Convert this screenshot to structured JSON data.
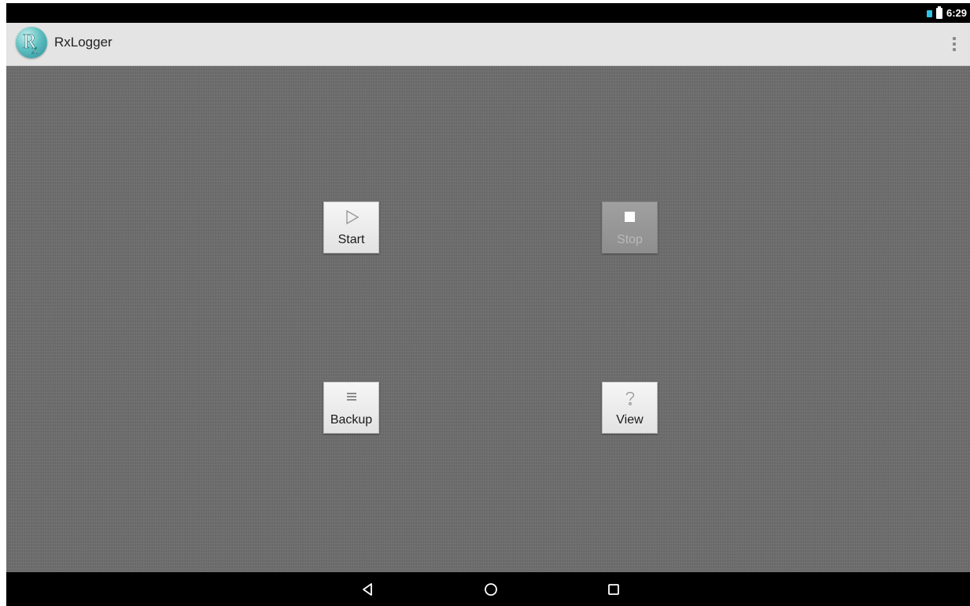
{
  "status_bar": {
    "time": "6:29",
    "icons": [
      "signal-icon",
      "battery-icon"
    ],
    "signal_color": "#2ec4e6"
  },
  "app_bar": {
    "title": "RxLogger",
    "logo_icon": "rx-logo-icon",
    "menu_icon": "overflow-menu-icon"
  },
  "actions": {
    "start": {
      "label": "Start",
      "icon": "play-icon",
      "enabled": true
    },
    "stop": {
      "label": "Stop",
      "icon": "stop-icon",
      "enabled": false
    },
    "backup": {
      "label": "Backup",
      "icon": "list-icon",
      "enabled": true
    },
    "view": {
      "label": "View",
      "icon": "question-icon",
      "enabled": true
    }
  },
  "nav_bar": {
    "buttons": [
      "back-icon",
      "home-icon",
      "recents-icon"
    ]
  },
  "colors": {
    "app_bar_bg": "#e4e4e4",
    "content_bg": "#6b6b6b",
    "logo_teal": "#5fc0c0"
  }
}
